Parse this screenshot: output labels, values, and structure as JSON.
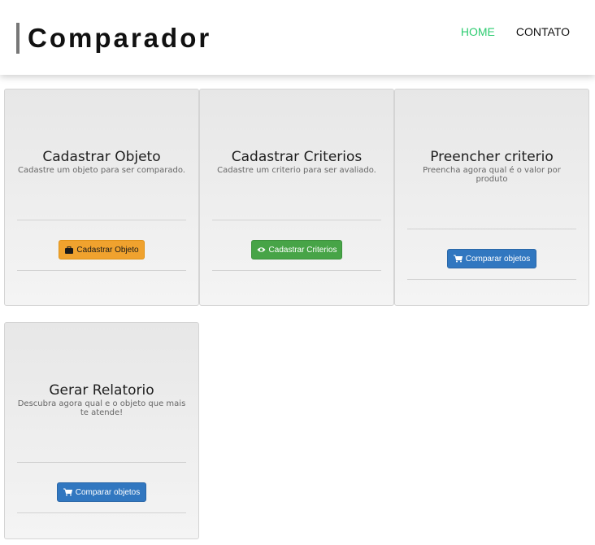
{
  "header": {
    "brand": "Comparador",
    "nav": [
      {
        "label": "HOME",
        "active": true
      },
      {
        "label": "CONTATO",
        "active": false
      }
    ]
  },
  "cards": [
    {
      "title": "Cadastrar Objeto",
      "description": "Cadastre um objeto para ser comparado.",
      "button": {
        "label": "Cadastrar Objeto",
        "icon": "briefcase-icon",
        "color": "#f0a22e"
      }
    },
    {
      "title": "Cadastrar Criterios",
      "description": "Cadastre um criterio para ser avaliado.",
      "button": {
        "label": "Cadastrar Criterios",
        "icon": "eye-icon",
        "color": "#47a447"
      }
    },
    {
      "title": "Preencher criterio",
      "description": "Preencha agora qual é o valor por produto",
      "button": {
        "label": "Comparar objetos",
        "icon": "cart-icon",
        "color": "#3177c0"
      }
    },
    {
      "title": "Gerar Relatorio",
      "description": "Descubra agora qual e o objeto que mais te atende!",
      "button": {
        "label": "Comparar objetos",
        "icon": "cart-icon",
        "color": "#3177c0"
      }
    }
  ],
  "colors": {
    "accent": "#2ecc71",
    "header_bar": "#777777"
  }
}
